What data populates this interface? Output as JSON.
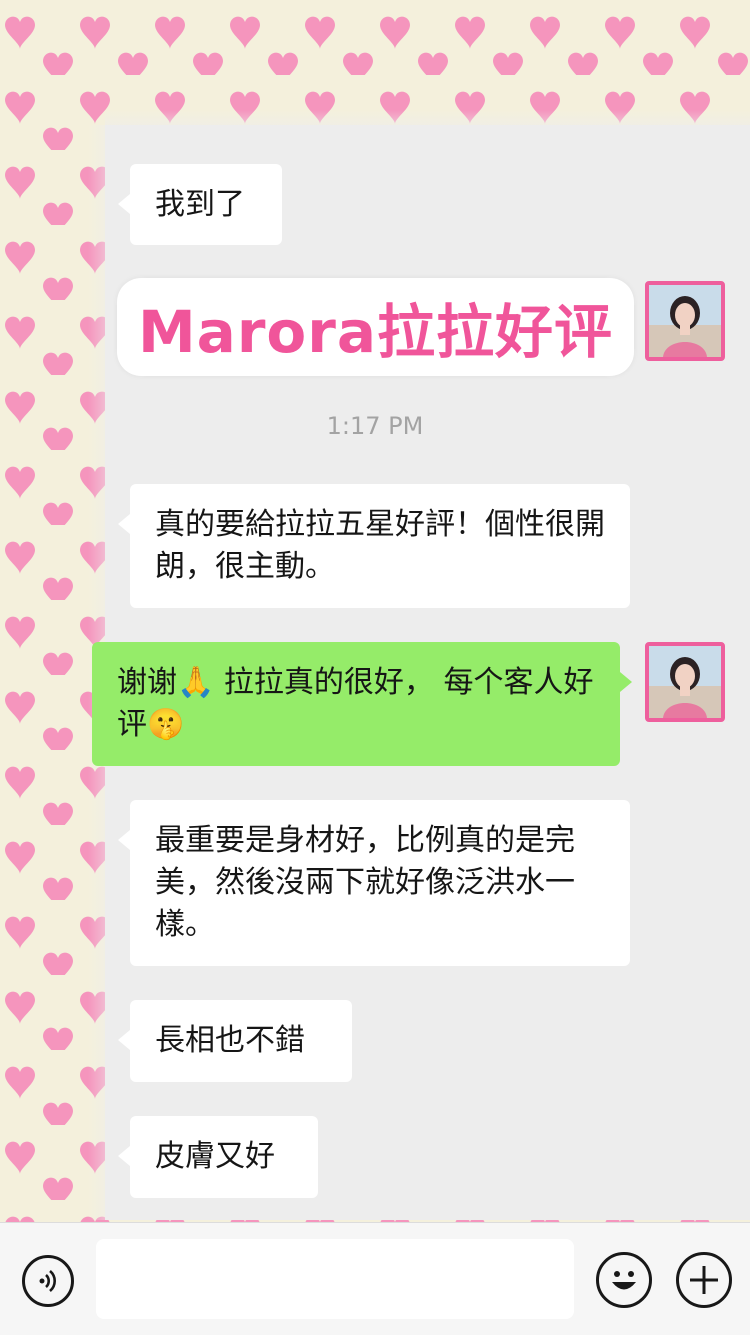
{
  "colors": {
    "heart": "#f595bd",
    "pattern_bg": "#f4f0dc",
    "chat_bg": "#ededed",
    "bubble_received": "#ffffff",
    "bubble_sent": "#95ec69",
    "promo_text": "#f0559a",
    "avatar_border": "#ee5f9d"
  },
  "messages": [
    {
      "id": "m1",
      "side": "left",
      "text": "我到了"
    },
    {
      "id": "m2",
      "side": "left",
      "text": "真的要給拉拉五星好評！個性很開朗，很主動。"
    },
    {
      "id": "m3",
      "side": "right",
      "text": "谢谢",
      "emoji1": "🙏",
      "text2": "拉拉真的很好， 每个客人好评",
      "emoji2": "🤫"
    },
    {
      "id": "m4",
      "side": "left",
      "text": "最重要是身材好，比例真的是完美，然後沒兩下就好像泛洪水一樣。"
    },
    {
      "id": "m5",
      "side": "left",
      "text": "長相也不錯"
    },
    {
      "id": "m6",
      "side": "left",
      "text": "皮膚又好"
    }
  ],
  "promo_text": "Marora拉拉好评",
  "timestamp": "1:17 PM",
  "input_bar": {
    "voice_icon": "voice-icon",
    "emoji_icon": "emoji-icon",
    "plus_icon": "plus-icon",
    "input_value": ""
  }
}
